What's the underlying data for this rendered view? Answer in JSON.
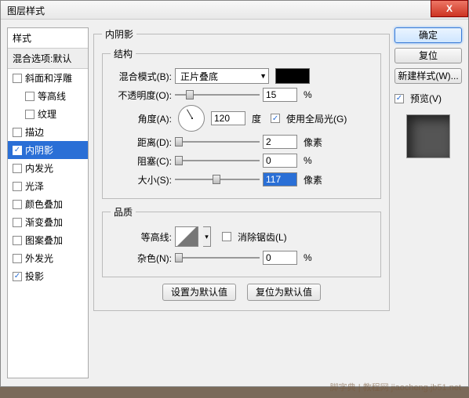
{
  "window": {
    "title": "图层样式"
  },
  "sidebar": {
    "header": "样式",
    "subheader": "混合选项:默认",
    "items": [
      {
        "label": "斜面和浮雕",
        "checked": false,
        "indent": false
      },
      {
        "label": "等高线",
        "checked": false,
        "indent": true
      },
      {
        "label": "纹理",
        "checked": false,
        "indent": true
      },
      {
        "label": "描边",
        "checked": false,
        "indent": false
      },
      {
        "label": "内阴影",
        "checked": true,
        "indent": false,
        "selected": true
      },
      {
        "label": "内发光",
        "checked": false,
        "indent": false
      },
      {
        "label": "光泽",
        "checked": false,
        "indent": false
      },
      {
        "label": "颜色叠加",
        "checked": false,
        "indent": false
      },
      {
        "label": "渐变叠加",
        "checked": false,
        "indent": false
      },
      {
        "label": "图案叠加",
        "checked": false,
        "indent": false
      },
      {
        "label": "外发光",
        "checked": false,
        "indent": false
      },
      {
        "label": "投影",
        "checked": true,
        "indent": false
      }
    ]
  },
  "panel": {
    "title": "内阴影",
    "structure_legend": "结构",
    "blend_label": "混合模式(B):",
    "blend_value": "正片叠底",
    "opacity_label": "不透明度(O):",
    "opacity_value": "15",
    "pct": "%",
    "angle_label": "角度(A):",
    "angle_value": "120",
    "degree": "度",
    "global_light": "使用全局光(G)",
    "distance_label": "距离(D):",
    "distance_value": "2",
    "px": "像素",
    "choke_label": "阻塞(C):",
    "choke_value": "0",
    "size_label": "大小(S):",
    "size_value": "117",
    "quality_legend": "品质",
    "contour_label": "等高线:",
    "antialias": "消除锯齿(L)",
    "noise_label": "杂色(N):",
    "noise_value": "0",
    "set_default": "设置为默认值",
    "reset_default": "复位为默认值"
  },
  "buttons": {
    "ok": "确定",
    "cancel": "复位",
    "newstyle": "新建样式(W)...",
    "preview": "预览(V)"
  },
  "watermark": "脚字典 | 教程网  jiaocheng.jb51.net"
}
